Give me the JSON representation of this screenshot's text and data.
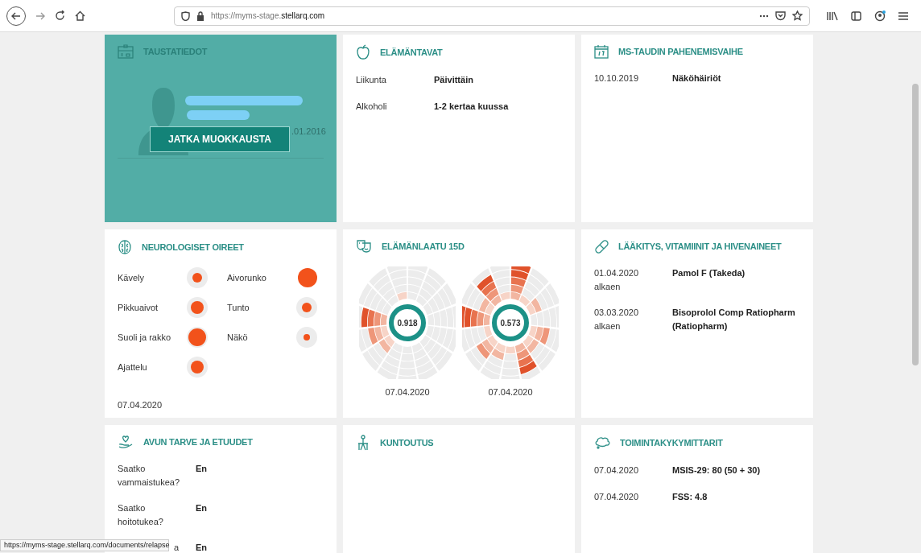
{
  "browser": {
    "url_prefix": "https://myms-stage.",
    "url_domain": "stellarq.com",
    "status_url": "https://myms-stage.stellarq.com/documents/relapse"
  },
  "cards": [
    {
      "kind": "profile",
      "title": "TAUSTATIEDOT",
      "date_fragment": ".01.2016",
      "button": "JATKA MUOKKAUSTA"
    },
    {
      "kind": "pairs",
      "title": "ELÄMÄNTAVAT",
      "rows": [
        {
          "label": "Liikunta",
          "value": "Päivittäin"
        },
        {
          "label": "Alkoholi",
          "value": "1-2 kertaa kuussa"
        }
      ]
    },
    {
      "kind": "pairs",
      "title": "MS-TAUDIN PAHENEMISVAIHE",
      "rows": [
        {
          "label": "10.10.2019",
          "value": "Näköhäiriöt"
        }
      ]
    },
    {
      "kind": "symptoms",
      "title": "NEUROLOGISET OIREET",
      "items": [
        {
          "label": "Kävely",
          "kind": "small"
        },
        {
          "label": "Aivorunko",
          "kind": "full"
        },
        {
          "label": "Pikkuaivot",
          "kind": "medium"
        },
        {
          "label": "Tunto",
          "kind": "small"
        },
        {
          "label": "Suoli ja rakko",
          "kind": "large"
        },
        {
          "label": "Näkö",
          "kind": "tiny"
        },
        {
          "label": "Ajattelu",
          "kind": "medium"
        }
      ],
      "date": "07.04.2020"
    },
    {
      "kind": "quality",
      "title": "ELÄMÄNLAATU 15D",
      "charts": [
        {
          "score": "0.918",
          "date": "07.04.2020"
        },
        {
          "score": "0.573",
          "date": "07.04.2020"
        }
      ]
    },
    {
      "kind": "pairs",
      "title": "LÄÄKITYS, VITAMIINIT JA HIVENAINEET",
      "rows": [
        {
          "label": "01.04.2020 alkaen",
          "value": "Pamol F (Takeda)"
        },
        {
          "label": "03.03.2020 alkaen",
          "value": "Bisoprolol Comp Ratiopharm (Ratiopharm)"
        }
      ]
    },
    {
      "kind": "pairs",
      "title": "AVUN TARVE JA ETUUDET",
      "rows": [
        {
          "label": "Saatko vammaistukea?",
          "value": "En"
        },
        {
          "label": "Saatko hoitotukea?",
          "value": "En"
        },
        {
          "label": "a",
          "value": "En",
          "obscured": true
        }
      ]
    },
    {
      "kind": "pairs",
      "title": "KUNTOUTUS"
    },
    {
      "kind": "pairs",
      "title": "TOIMINTAKYKYMITTARIT",
      "rows": [
        {
          "label": "07.04.2020",
          "value": "MSIS-29: 80 (50 + 30)"
        },
        {
          "label": "07.04.2020",
          "value": "FSS: 4.8"
        }
      ]
    }
  ]
}
